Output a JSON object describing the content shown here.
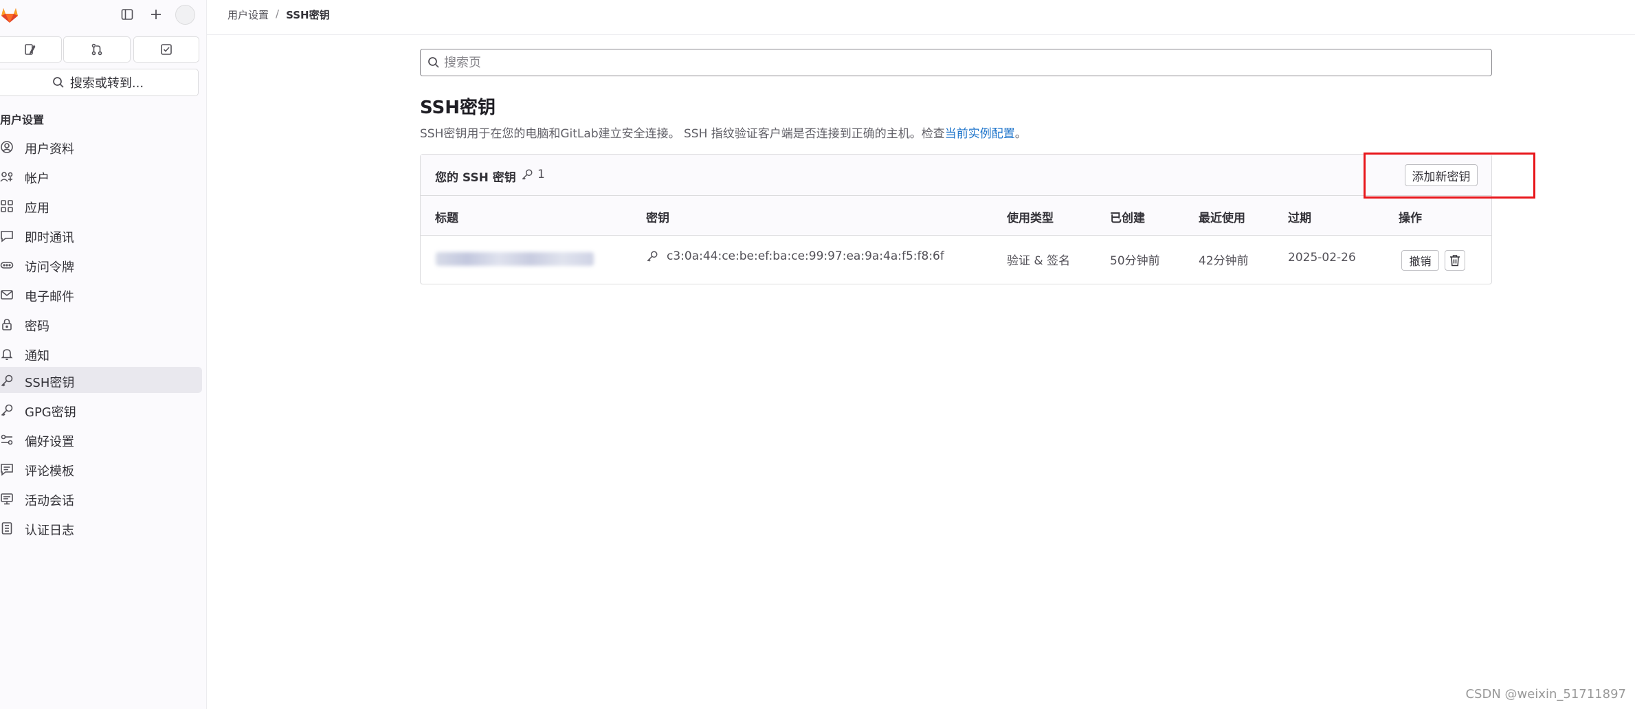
{
  "sidebar": {
    "search_label": "搜索或转到...",
    "section_title": "用户设置",
    "items": [
      {
        "label": "用户资料",
        "icon": "profile-icon",
        "active": false
      },
      {
        "label": "帐户",
        "icon": "account-icon",
        "active": false
      },
      {
        "label": "应用",
        "icon": "applications-icon",
        "active": false
      },
      {
        "label": "即时通讯",
        "icon": "chat-icon",
        "active": false
      },
      {
        "label": "访问令牌",
        "icon": "token-icon",
        "active": false
      },
      {
        "label": "电子邮件",
        "icon": "mail-icon",
        "active": false
      },
      {
        "label": "密码",
        "icon": "lock-icon",
        "active": false
      },
      {
        "label": "通知",
        "icon": "bell-icon",
        "active": false
      },
      {
        "label": "SSH密钥",
        "icon": "key-icon",
        "active": true
      },
      {
        "label": "GPG密钥",
        "icon": "key-icon",
        "active": false
      },
      {
        "label": "偏好设置",
        "icon": "preferences-icon",
        "active": false
      },
      {
        "label": "评论模板",
        "icon": "comment-template-icon",
        "active": false
      },
      {
        "label": "活动会话",
        "icon": "monitor-icon",
        "active": false
      },
      {
        "label": "认证日志",
        "icon": "log-icon",
        "active": false
      }
    ]
  },
  "breadcrumb": {
    "parent": "用户设置",
    "separator": "/",
    "current": "SSH密钥"
  },
  "search": {
    "placeholder": "搜索页"
  },
  "page": {
    "title": "SSH密钥",
    "description_prefix": "SSH密钥用于在您的电脑和GitLab建立安全连接。 SSH 指纹验证客户端是否连接到正确的主机。检查",
    "description_link": "当前实例配置",
    "description_suffix": "。"
  },
  "keys_card": {
    "title": "您的 SSH 密钥",
    "count": "1",
    "add_button": "添加新密钥",
    "columns": [
      "标题",
      "密钥",
      "使用类型",
      "已创建",
      "最近使用",
      "过期",
      "操作"
    ],
    "rows": [
      {
        "fingerprint": "c3:0a:44:ce:be:ef:ba:ce:99:97:ea:9a:4a:f5:f8:6f",
        "usage": "验证 & 签名",
        "created": "50分钟前",
        "last_used": "42分钟前",
        "expires": "2025-02-26",
        "revoke_label": "撤销"
      }
    ]
  },
  "colors": {
    "accent_link": "#1f75cb",
    "highlight": "#e8161b",
    "active_nav_bg": "#e9e8ee"
  },
  "watermark": "CSDN @weixin_51711897"
}
